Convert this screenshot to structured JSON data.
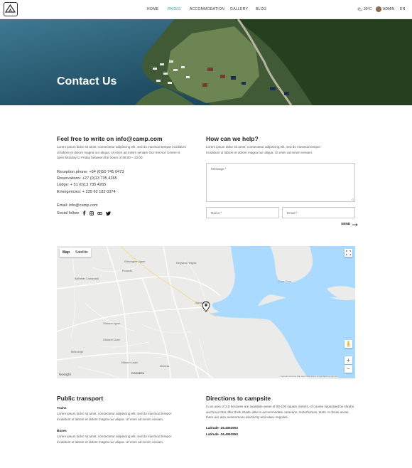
{
  "header": {
    "nav": [
      {
        "label": "HOME"
      },
      {
        "label": "PAGES"
      },
      {
        "label": "ACCOMMODATION"
      },
      {
        "label": "GALLERY"
      },
      {
        "label": "BLOG"
      }
    ],
    "weather": "30°C",
    "user": "ADMIN",
    "language": "EN"
  },
  "hero": {
    "title": "Contact Us"
  },
  "contact": {
    "heading": "Feel free to write on info@camp.com",
    "intro": "Lorem ipsum dolor sit amet, consectetur adipiscing elit, sed do eiusmod tempor incididunt ut labore et dolore magna our aliqua. Ut enim ad minim veniam Our Service Centre is open Monday to Friday between the hours of 08:00 – 10:00",
    "reception": "Reception phone: +64 (0)50 745 6473",
    "reservations": "Reservations: +27 (0)13 735 4265",
    "lodge": "Lodge: + 51 (0)13 735 4265",
    "emergencies": "Emergencies: + 235 62 182 0374",
    "email": "Email: info@camp.com",
    "social_label": "Social follow"
  },
  "help": {
    "heading": "How can we help?",
    "intro": "Lorem ipsum dolor sit amet, consectetur adipiscing elit, sed do eiusmod tempor incididunt ut labore et dolore magna our aliqua. Ut enim ad minim veniam.",
    "message_placeholder": "Message *",
    "name_placeholder": "Name *",
    "email_placeholder": "Email *",
    "send_label": "SEND"
  },
  "map": {
    "tabs": [
      {
        "label": "Map"
      },
      {
        "label": "Satellite"
      }
    ],
    "places": [
      {
        "label": "Killeclogher Upper"
      },
      {
        "label": "Pickards"
      },
      {
        "label": "Ballinteer Crossroads"
      },
      {
        "label": "Ringsend Heights"
      },
      {
        "label": "Sandycove"
      },
      {
        "label": "Oldcourt Upper"
      },
      {
        "label": "Oldcourt Close"
      },
      {
        "label": "Bellevergh"
      },
      {
        "label": "Oldcourt Lower"
      },
      {
        "label": "Kilbrews"
      },
      {
        "label": "DOONEEN"
      },
      {
        "label": "Cove Cove"
      }
    ],
    "footer": "Keyboard shortcuts   Map data ©2021   Terms of Use   Report a map error",
    "google": "Google"
  },
  "transport": {
    "heading": "Public transport",
    "trains_title": "Trains",
    "trains_text": "Lorem ipsum dolor sit amet, consectetur adipiscing elit, sed do eiusmod tempor incididunt ut labore et dolore magna our aliqua. Ut enim ad minim veniam.",
    "buses_title": "Buses",
    "buses_text": "Lorem ipsum dolor sit amet, consectetur adipiscing elit, sed do eiusmod tempor incididunt ut labore et dolore magna our aliqua. Ut enim ad minim veniam."
  },
  "directions": {
    "heading": "Directions to campsite",
    "text": "In an area of 3.8 hectares are available areas of 80-100 square meters, of course separated by shrubs and trees that offer thick shade able to accommodate caravans, motorhomes, tents. In these areas there are also autonomous electricity and water supplies.",
    "lat1": "Latitude  -26.4063953",
    "lat2": "Latitude  -26.4063953"
  },
  "colors": {
    "accent": "#2aa198",
    "water": "#aadaff",
    "land": "#ebebea"
  }
}
